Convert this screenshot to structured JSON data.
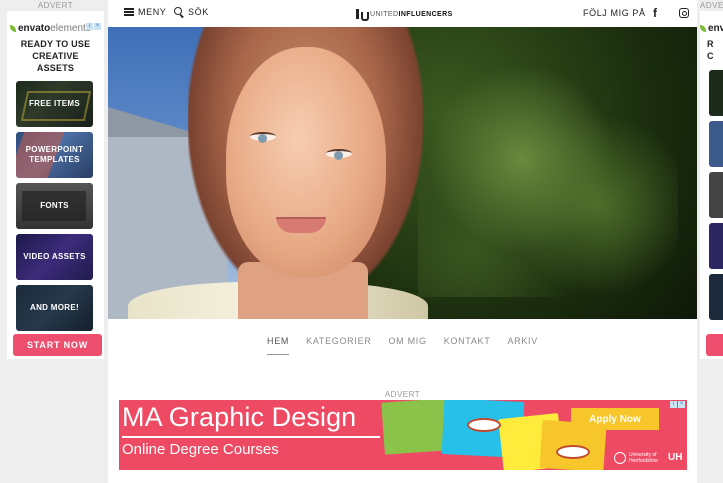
{
  "left_ad": {
    "advert_label": "ADVERT",
    "logo_part1": "envato",
    "logo_part2": "elements",
    "tagline": "READY TO USE CREATIVE ASSETS",
    "tiles": [
      {
        "label": "FREE ITEMS"
      },
      {
        "label": "POWERPOINT TEMPLATES"
      },
      {
        "label": "FONTS"
      },
      {
        "label": "VIDEO ASSETS"
      },
      {
        "label": "AND MORE!"
      }
    ],
    "cta": "START NOW"
  },
  "right_ad": {
    "advert_label": "ADVERT",
    "logo_part1": "envato",
    "tagline_letters": "R C"
  },
  "topbar": {
    "menu_label": "MENY",
    "search_label": "SÖK",
    "brand_part1": "UNITED",
    "brand_part2": "INFLUENCERS",
    "follow_label": "FÖLJ MIG PÅ",
    "facebook_glyph": "f"
  },
  "nav": {
    "items": [
      "HEM",
      "KATEGORIER",
      "OM MIG",
      "KONTAKT",
      "ARKIV"
    ],
    "active": "HEM"
  },
  "banner": {
    "advert_label": "ADVERT",
    "headline": "MA Graphic Design",
    "subheadline": "Online Degree Courses",
    "apply_label": "Apply Now",
    "uni_text": "University of Hertfordshire",
    "uni_mark": "UH"
  },
  "colors": {
    "accent_pink": "#ee4f6f",
    "banner_red": "#ee4a63",
    "envato_green": "#7bbb2f"
  }
}
